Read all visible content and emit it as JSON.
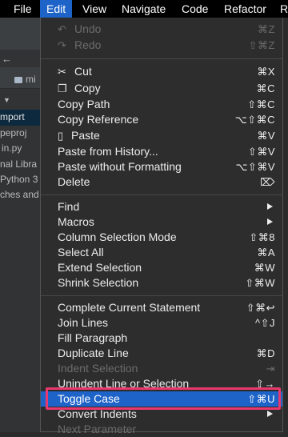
{
  "menubar": {
    "items": [
      "File",
      "Edit",
      "View",
      "Navigate",
      "Code",
      "Refactor",
      "R"
    ]
  },
  "ide": {
    "lines": [
      "mi",
      "mport",
      "peproj",
      "in.py",
      "nal Libra",
      "Python 3",
      "ches and"
    ]
  },
  "menu": {
    "items": [
      {
        "label": "Undo",
        "shortcut": "⌘Z",
        "icon": "undo-icon",
        "disabled": true
      },
      {
        "label": "Redo",
        "shortcut": "⇧⌘Z",
        "icon": "redo-icon",
        "disabled": true
      },
      {
        "label": "Cut",
        "shortcut": "⌘X",
        "icon": "scissors-icon"
      },
      {
        "label": "Copy",
        "shortcut": "⌘C",
        "icon": "copy-icon"
      },
      {
        "label": "Copy Path",
        "shortcut": "⇧⌘C"
      },
      {
        "label": "Copy Reference",
        "shortcut": "⌥⇧⌘C"
      },
      {
        "label": "Paste",
        "shortcut": "⌘V",
        "icon": "clipboard-icon"
      },
      {
        "label": "Paste from History...",
        "shortcut": "⇧⌘V"
      },
      {
        "label": "Paste without Formatting",
        "shortcut": "⌥⇧⌘V"
      },
      {
        "label": "Delete",
        "shortcut": "⌦"
      },
      {
        "label": "Find",
        "submenu": true
      },
      {
        "label": "Macros",
        "submenu": true
      },
      {
        "label": "Column Selection Mode",
        "shortcut": "⇧⌘8"
      },
      {
        "label": "Select All",
        "shortcut": "⌘A"
      },
      {
        "label": "Extend Selection",
        "shortcut": "⌘W"
      },
      {
        "label": "Shrink Selection",
        "shortcut": "⇧⌘W"
      },
      {
        "label": "Complete Current Statement",
        "shortcut": "⇧⌘↩"
      },
      {
        "label": "Join Lines",
        "shortcut": "^⇧J"
      },
      {
        "label": "Fill Paragraph",
        "shortcut": ""
      },
      {
        "label": "Duplicate Line",
        "shortcut": "⌘D"
      },
      {
        "label": "Indent Selection",
        "shortcut": "",
        "disabled": true
      },
      {
        "label": "Unindent Line or Selection",
        "shortcut": "⇧→"
      },
      {
        "label": "Toggle Case",
        "shortcut": "⇧⌘U",
        "selected": true
      },
      {
        "label": "Convert Indents",
        "submenu": true
      },
      {
        "label": "Next Parameter",
        "shortcut": "",
        "disabled": true
      }
    ]
  },
  "colors": {
    "accent": "#1e63c8",
    "highlight_border": "#e8386d",
    "menu_bg": "#2d2d2d"
  }
}
